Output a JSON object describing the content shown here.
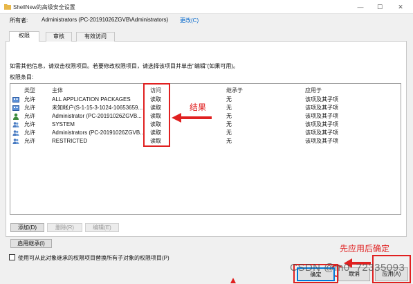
{
  "window": {
    "title": "ShellNew的高级安全设置"
  },
  "owner": {
    "label": "所有者:",
    "value": "Administrators (PC-20191026ZGVB\\Administrators)",
    "change_link": "更改(C)"
  },
  "tabs": [
    {
      "label": "权限"
    },
    {
      "label": "审核"
    },
    {
      "label": "有效访问"
    }
  ],
  "info_text": "如需其他信息，请双击权限项目。若要修改权限项目，请选择该项目并单击\"编辑\"(如果可用)。",
  "entries_label": "权限条目:",
  "columns": {
    "type": "类型",
    "principal": "主体",
    "access": "访问",
    "inherited_from": "继承于",
    "applies_to": "应用于"
  },
  "entries": [
    {
      "type": "允许",
      "principal": "ALL APPLICATION PACKAGES",
      "access": "读取",
      "inherited_from": "无",
      "applies_to": "该项及其子项"
    },
    {
      "type": "允许",
      "principal": "未知帐户(S-1-15-3-1024-10653659...",
      "access": "读取",
      "inherited_from": "无",
      "applies_to": "该项及其子项"
    },
    {
      "type": "允许",
      "principal": "Administrator (PC-20191026ZGVB...",
      "access": "读取",
      "inherited_from": "无",
      "applies_to": "该项及其子项"
    },
    {
      "type": "允许",
      "principal": "SYSTEM",
      "access": "读取",
      "inherited_from": "无",
      "applies_to": "该项及其子项"
    },
    {
      "type": "允许",
      "principal": "Administrators (PC-20191026ZGVB...",
      "access": "读取",
      "inherited_from": "无",
      "applies_to": "该项及其子项"
    },
    {
      "type": "允许",
      "principal": "RESTRICTED",
      "access": "读取",
      "inherited_from": "无",
      "applies_to": "该项及其子项"
    }
  ],
  "buttons": {
    "add": "添加(D)",
    "remove": "删除(R)",
    "edit": "编辑(E)",
    "enable_inheritance": "启用继承(I)",
    "ok": "确定",
    "cancel": "取消",
    "apply": "应用(A)"
  },
  "replace_checkbox": {
    "label": "使用可从此对象继承的权限项目替换所有子对象的权限项目(P)",
    "checked": false
  },
  "annotations": {
    "result": "结果",
    "apply_first": "先应用后确定"
  },
  "watermark": "CSDN @m0_72335093",
  "colors": {
    "annotation_red": "#e02020",
    "link_blue": "#0066cc",
    "focus_blue": "#0078d7"
  }
}
